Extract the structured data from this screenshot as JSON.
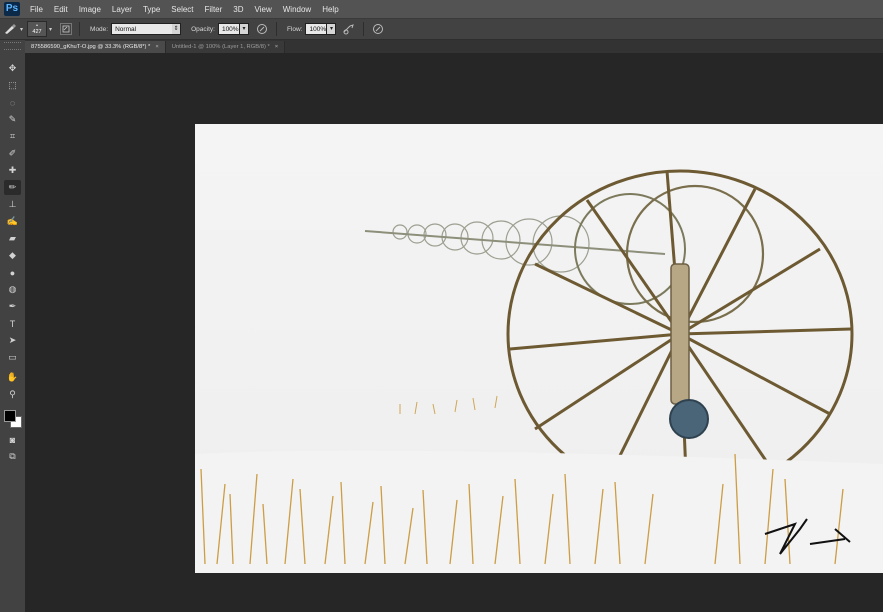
{
  "app": {
    "logo": "Ps"
  },
  "menu": [
    "File",
    "Edit",
    "Image",
    "Layer",
    "Type",
    "Select",
    "Filter",
    "3D",
    "View",
    "Window",
    "Help"
  ],
  "options": {
    "brush_size": "427",
    "mode_label": "Mode:",
    "mode_value": "Normal",
    "opacity_label": "Opacity:",
    "opacity_value": "100%",
    "flow_label": "Flow:",
    "flow_value": "100%"
  },
  "tabs": [
    {
      "label": "875586590_gKhuT-O.jpg @ 33.3% (RGB/8*) *",
      "close": "×"
    },
    {
      "label": "Untitled-1 @ 100% (Layer 1, RGB/8) *",
      "close": "×"
    }
  ],
  "tools": [
    {
      "name": "move-tool",
      "icon": "move-icon",
      "glyph": "✥"
    },
    {
      "name": "marquee-tool",
      "icon": "rect-marquee-icon",
      "glyph": "⬚"
    },
    {
      "name": "lasso-tool",
      "icon": "lasso-icon",
      "glyph": "◌"
    },
    {
      "name": "quick-select-tool",
      "icon": "quick-select-icon",
      "glyph": "✎"
    },
    {
      "name": "crop-tool",
      "icon": "crop-icon",
      "glyph": "⌗"
    },
    {
      "name": "eyedropper-tool",
      "icon": "eyedropper-icon",
      "glyph": "✐"
    },
    {
      "name": "healing-brush-tool",
      "icon": "bandage-icon",
      "glyph": "✚"
    },
    {
      "name": "brush-tool",
      "icon": "brush-icon",
      "glyph": "✏"
    },
    {
      "name": "clone-stamp-tool",
      "icon": "stamp-icon",
      "glyph": "⊥"
    },
    {
      "name": "history-brush-tool",
      "icon": "history-brush-icon",
      "glyph": "✍"
    },
    {
      "name": "eraser-tool",
      "icon": "eraser-icon",
      "glyph": "▰"
    },
    {
      "name": "paint-bucket-tool",
      "icon": "bucket-icon",
      "glyph": "◆"
    },
    {
      "name": "blur-tool",
      "icon": "drop-icon",
      "glyph": "●"
    },
    {
      "name": "dodge-tool",
      "icon": "dodge-icon",
      "glyph": "◍"
    },
    {
      "name": "pen-tool",
      "icon": "pen-icon",
      "glyph": "✒"
    },
    {
      "name": "type-tool",
      "icon": "type-icon",
      "glyph": "T"
    },
    {
      "name": "path-select-tool",
      "icon": "arrow-icon",
      "glyph": "➤"
    },
    {
      "name": "shape-tool",
      "icon": "rectangle-icon",
      "glyph": "▭"
    },
    {
      "name": "hand-tool",
      "icon": "hand-icon",
      "glyph": "✋"
    },
    {
      "name": "zoom-tool",
      "icon": "zoom-icon",
      "glyph": "⚲"
    }
  ],
  "colors": {
    "foreground": "#000000",
    "background": "#ffffff",
    "ui_dark": "#262626",
    "ui_panel": "#424242"
  }
}
